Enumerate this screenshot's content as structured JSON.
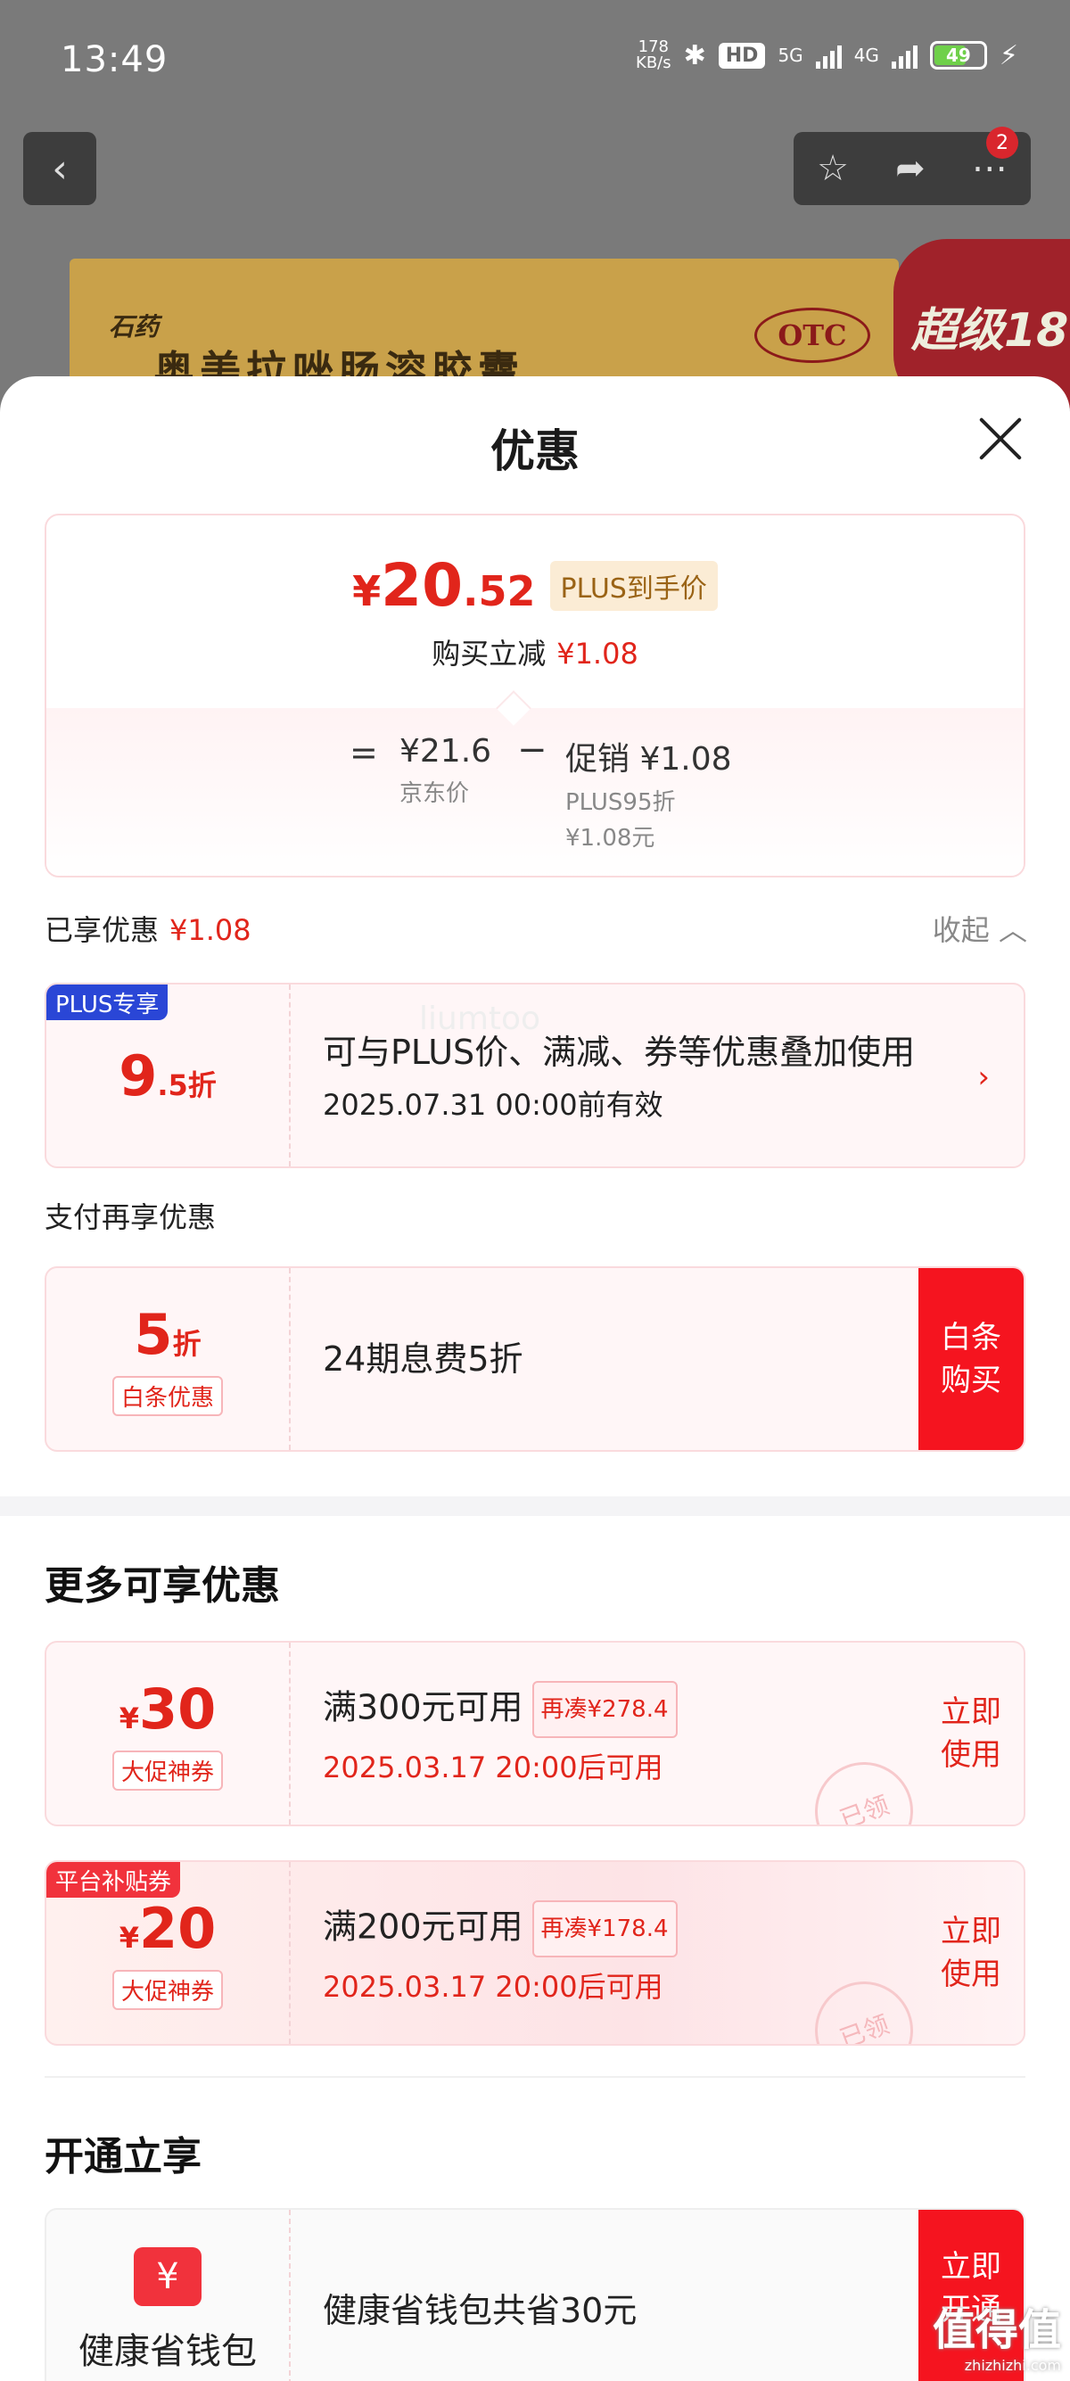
{
  "status_bar": {
    "time": "13:49",
    "net_speed_value": "178",
    "net_speed_unit": "KB/s",
    "hd_label": "HD",
    "net_5g": "5G",
    "net_4g": "4G",
    "battery": "49"
  },
  "product": {
    "brand": "石药",
    "name": "奥美拉唑肠溶胶囊",
    "otc": "OTC",
    "promo_tag": "超级18",
    "cart_badge": "2"
  },
  "sheet": {
    "title": "优惠",
    "price": {
      "currency": "¥",
      "integer": "20",
      "decimal": ".52",
      "tag": "PLUS到手价",
      "save_label": "购买立减",
      "save_amount": "¥1.08"
    },
    "calc": {
      "eq": "=",
      "jd_price": "¥21.6",
      "jd_label": "京东价",
      "minus": "−",
      "promo_value": "促销 ¥1.08",
      "promo_line1": "PLUS95折",
      "promo_line2": "¥1.08元"
    },
    "enjoyed": {
      "label": "已享优惠",
      "amount": "¥1.08",
      "collapse": "收起"
    },
    "plus_coupon": {
      "tag": "PLUS专享",
      "discount_num": "9",
      "discount_suffix": ".5折",
      "desc": "可与PLUS价、满减、券等优惠叠加使用",
      "valid": "2025.07.31 00:00前有效"
    },
    "pay_section_label": "支付再享优惠",
    "baitiao": {
      "discount_num": "5",
      "discount_suffix": "折",
      "sub_label": "白条优惠",
      "desc": "24期息费5折",
      "button": "白条\n购买"
    },
    "more_title": "更多可享优惠",
    "coupons": [
      {
        "amount": "30",
        "yen": "¥",
        "sub_label": "大促神券",
        "condition": "满300元可用",
        "remaining": "再凑¥278.4",
        "time": "2025.03.17 20:00后可用",
        "button": "立即\n使用",
        "stamp": "已领"
      },
      {
        "tag": "平台补贴券",
        "amount": "20",
        "yen": "¥",
        "sub_label": "大促神券",
        "condition": "满200元可用",
        "remaining": "再凑¥178.4",
        "time": "2025.03.17 20:00后可用",
        "button": "立即\n使用",
        "stamp": "已领"
      }
    ],
    "open_title": "开通立享",
    "wallet": {
      "icon_glyph": "¥",
      "label": "健康省钱包",
      "desc": "健康省钱包共省30元",
      "button": "立即\n开通"
    },
    "watermark": "liumtoo",
    "corner_watermark": "值得值",
    "corner_watermark_url": "zhizhizhi.com"
  }
}
